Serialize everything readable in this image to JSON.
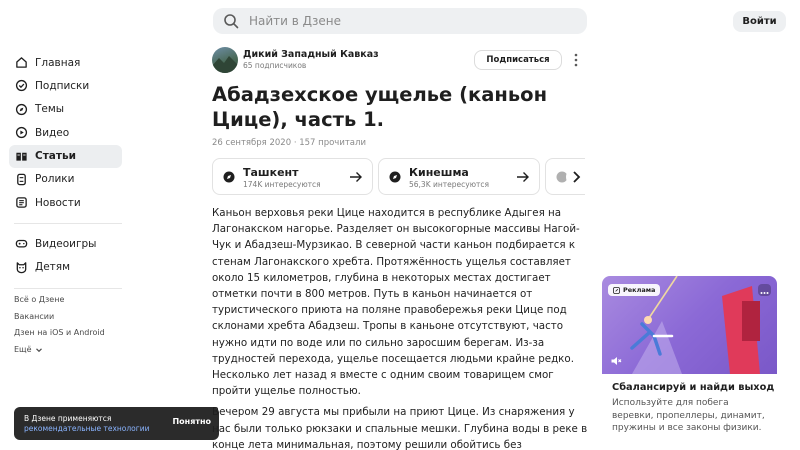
{
  "search": {
    "placeholder": "Найти в Дзене"
  },
  "header": {
    "login_label": "Войти"
  },
  "sidebar": {
    "items": [
      {
        "label": "Главная",
        "icon": "home-icon"
      },
      {
        "label": "Подписки",
        "icon": "subscriptions-icon"
      },
      {
        "label": "Темы",
        "icon": "topics-icon"
      },
      {
        "label": "Видео",
        "icon": "video-icon"
      },
      {
        "label": "Статьи",
        "icon": "articles-icon",
        "active": true
      },
      {
        "label": "Ролики",
        "icon": "shorts-icon"
      },
      {
        "label": "Новости",
        "icon": "news-icon"
      }
    ],
    "items2": [
      {
        "label": "Видеоигры",
        "icon": "gamepad-icon"
      },
      {
        "label": "Детям",
        "icon": "kids-icon"
      }
    ],
    "links": [
      "Всё о Дзене",
      "Вакансии",
      "Дзен на iOS и Android"
    ],
    "more_label": "Ещё"
  },
  "toast": {
    "text": "В Дзене применяются",
    "link": "рекомендательные технологии",
    "button": "Понятно"
  },
  "channel": {
    "name": "Дикий Западный Кавказ",
    "subscribers": "65 подписчиков",
    "subscribe_label": "Подписаться"
  },
  "article": {
    "title": "Абадзехское ущелье (каньон Цице), часть 1.",
    "meta": "26 сентября 2020 · 157 прочитали",
    "paragraphs": [
      "Каньон верховья реки Цице находится в республике Адыгея на Лагонакском нагорье. Разделяет он высокогорные массивы Нагой-Чук и Абадзеш-Мурзикао. В северной части каньон подбирается к стенам Лагонакского хребта. Протяжённость ущелья составляет около 15 километров, глубина в некоторых местах достигает отметки почти в 800 метров. Путь в каньон начинается от туристического приюта на поляне правобережья реки Цице под склонами хребта Абадзеш. Тропы в каньоне отсутствуют, часто нужно идти по воде или по сильно заросшим берегам. Из-за трудностей перехода, ущелье посещается людьми крайне редко. Несколько лет назад я вместе с одним своим товарищем смог пройти ущелье полностью.",
      "Вечером 29 августа мы прибыли на приют Цице. Из снаряжения у нас были только рюкзаки и спальные мешки. Глубина воды в реке в конце лета минимальная, поэтому решили обойтись без"
    ]
  },
  "topics": [
    {
      "name": "Ташкент",
      "count": "174K интересуются"
    },
    {
      "name": "Кинешма",
      "count": "56,3K интересуются"
    }
  ],
  "ad": {
    "badge": "Реклама",
    "title": "Сбалансируй и найди выход",
    "description": "Используйте для побега веревки, пропеллеры, динамит, пружины и все законы физики."
  },
  "colors": {
    "accent": "#1f1f1f",
    "ad_bg": "#8b69d6",
    "toast_bg": "#2b2b2b",
    "link": "#8ab4ff"
  }
}
